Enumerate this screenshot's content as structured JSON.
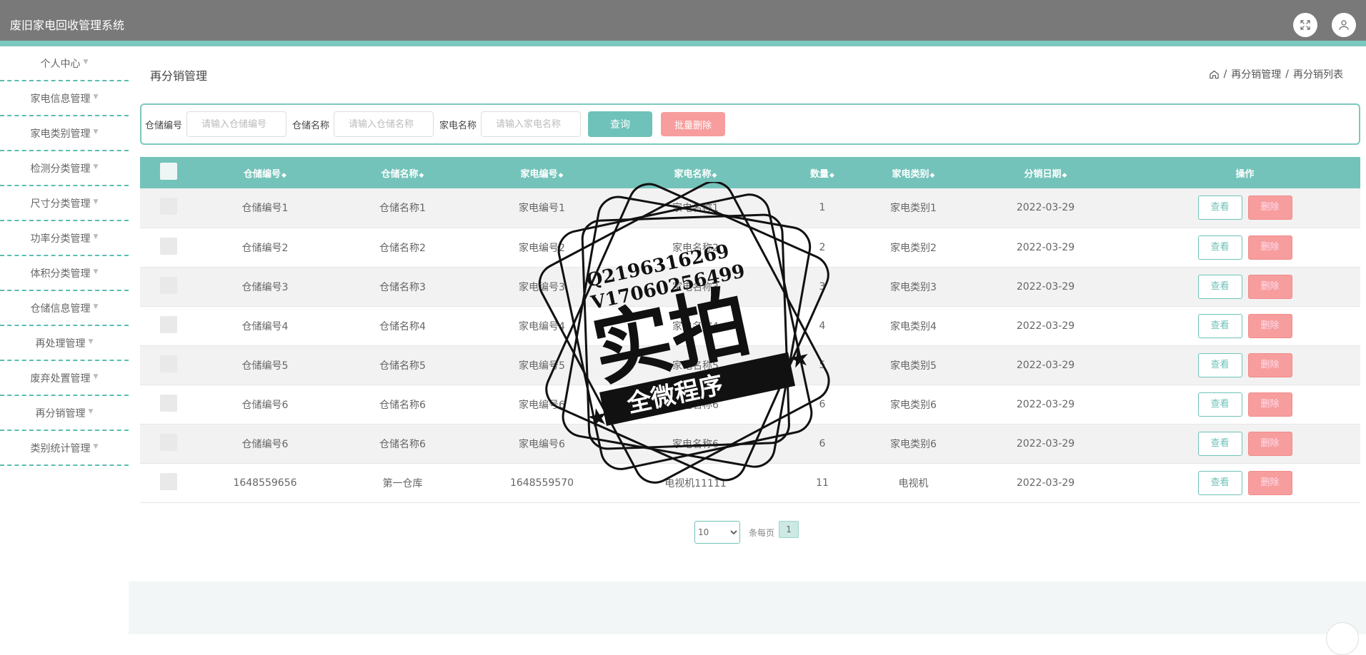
{
  "app": {
    "title": "废旧家电回收管理系统"
  },
  "header": {
    "icons": [
      "fullscreen-icon",
      "user-icon"
    ]
  },
  "sidebar": {
    "items": [
      {
        "label": "个人中心"
      },
      {
        "label": "家电信息管理"
      },
      {
        "label": "家电类别管理"
      },
      {
        "label": "检测分类管理"
      },
      {
        "label": "尺寸分类管理"
      },
      {
        "label": "功率分类管理"
      },
      {
        "label": "体积分类管理"
      },
      {
        "label": "仓储信息管理"
      },
      {
        "label": "再处理管理"
      },
      {
        "label": "废弃处置管理"
      },
      {
        "label": "再分销管理"
      },
      {
        "label": "类别统计管理"
      }
    ]
  },
  "page": {
    "title": "再分销管理"
  },
  "breadcrumb": {
    "items": [
      "再分销管理",
      "再分销列表"
    ],
    "separator": "/"
  },
  "search": {
    "fields": [
      {
        "label": "仓储编号",
        "placeholder": "请输入仓储编号"
      },
      {
        "label": "仓储名称",
        "placeholder": "请输入仓储名称"
      },
      {
        "label": "家电名称",
        "placeholder": "请输入家电名称"
      }
    ],
    "query_label": "查询",
    "batch_delete_label": "批量删除"
  },
  "table": {
    "columns": [
      "仓储编号",
      "仓储名称",
      "家电编号",
      "家电名称",
      "数量",
      "家电类别",
      "分销日期",
      "操作"
    ],
    "rows": [
      [
        "仓储编号1",
        "仓储名称1",
        "家电编号1",
        "家电名称1",
        "1",
        "家电类别1",
        "2022-03-29"
      ],
      [
        "仓储编号2",
        "仓储名称2",
        "家电编号2",
        "家电名称2",
        "2",
        "家电类别2",
        "2022-03-29"
      ],
      [
        "仓储编号3",
        "仓储名称3",
        "家电编号3",
        "家电名称3",
        "3",
        "家电类别3",
        "2022-03-29"
      ],
      [
        "仓储编号4",
        "仓储名称4",
        "家电编号4",
        "家电名称4",
        "4",
        "家电类别4",
        "2022-03-29"
      ],
      [
        "仓储编号5",
        "仓储名称5",
        "家电编号5",
        "家电名称5",
        "5",
        "家电类别5",
        "2022-03-29"
      ],
      [
        "仓储编号6",
        "仓储名称6",
        "家电编号6",
        "家电名称6",
        "6",
        "家电类别6",
        "2022-03-29"
      ],
      [
        "仓储编号6",
        "仓储名称6",
        "家电编号6",
        "家电名称6",
        "6",
        "家电类别6",
        "2022-03-29"
      ],
      [
        "1648559656",
        "第一仓库",
        "1648559570",
        "电视机11111",
        "11",
        "电视机",
        "2022-03-29"
      ]
    ],
    "view_label": "查看",
    "delete_label": "删除"
  },
  "pagination": {
    "page_size": "10",
    "per_page_label": "条每页",
    "current_page": "1"
  },
  "watermark": {
    "lines": [
      "Q2196316269",
      "V17060256499",
      "实拍",
      "全微程序"
    ]
  },
  "colors": {
    "header": "#797979",
    "accent": "#73c3ba",
    "danger": "#f79d9d"
  }
}
